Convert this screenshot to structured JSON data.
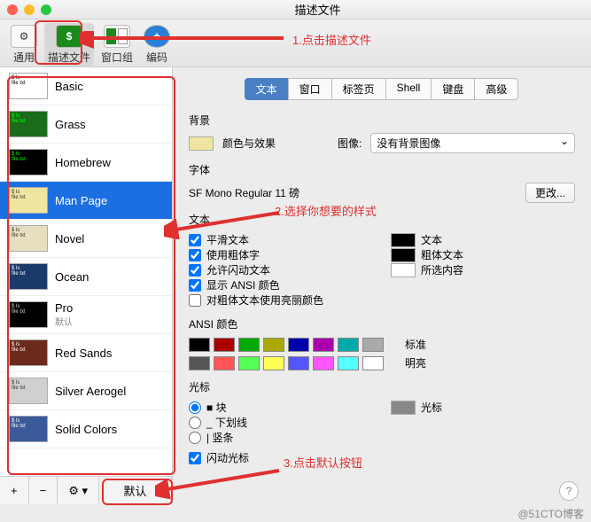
{
  "window": {
    "title": "描述文件"
  },
  "annotations": {
    "a1": "1.点击描述文件",
    "a2": "2.选择你想要的样式",
    "a3": "3.点击默认按钮",
    "watermark": "@51CTO博客"
  },
  "toolbar": {
    "general": "通用",
    "profiles": "描述文件",
    "groups": "窗口组",
    "encoding": "编码"
  },
  "profiles": [
    {
      "name": "Basic",
      "sub": "",
      "cls": "basic"
    },
    {
      "name": "Grass",
      "sub": "",
      "cls": "grass"
    },
    {
      "name": "Homebrew",
      "sub": "",
      "cls": "homebrew"
    },
    {
      "name": "Man Page",
      "sub": "",
      "cls": "manpage",
      "selected": true
    },
    {
      "name": "Novel",
      "sub": "",
      "cls": "novel"
    },
    {
      "name": "Ocean",
      "sub": "",
      "cls": "ocean"
    },
    {
      "name": "Pro",
      "sub": "默认",
      "cls": "pro"
    },
    {
      "name": "Red Sands",
      "sub": "",
      "cls": "redsands"
    },
    {
      "name": "Silver Aerogel",
      "sub": "",
      "cls": "silver"
    },
    {
      "name": "Solid Colors",
      "sub": "",
      "cls": "solid"
    }
  ],
  "sidebtns": {
    "add": "+",
    "remove": "−",
    "gear": "⚙︎ ▾",
    "default": "默认"
  },
  "tabs": [
    "文本",
    "窗口",
    "标签页",
    "Shell",
    "键盘",
    "高级"
  ],
  "active_tab": 0,
  "bg": {
    "section": "背景",
    "color_label": "颜色与效果",
    "image_label": "图像:",
    "image_select": "没有背景图像"
  },
  "font": {
    "section": "字体",
    "current": "SF Mono Regular 11 磅",
    "change": "更改..."
  },
  "text": {
    "section": "文本",
    "checks": [
      {
        "label": "平滑文本",
        "checked": true
      },
      {
        "label": "使用粗体字",
        "checked": true
      },
      {
        "label": "允许闪动文本",
        "checked": true
      },
      {
        "label": "显示 ANSI 颜色",
        "checked": true
      },
      {
        "label": "对粗体文本使用亮丽颜色",
        "checked": false
      }
    ],
    "right": [
      {
        "label": "文本",
        "color": "#000"
      },
      {
        "label": "粗体文本",
        "color": "#000"
      },
      {
        "label": "所选内容",
        "color": "#fff"
      }
    ]
  },
  "ansi": {
    "section": "ANSI 颜色",
    "row1": [
      "#000000",
      "#aa0000",
      "#00aa00",
      "#aaaa00",
      "#0000aa",
      "#aa00aa",
      "#00aaaa",
      "#aaaaaa"
    ],
    "row2": [
      "#555555",
      "#ff5555",
      "#55ff55",
      "#ffff55",
      "#5555ff",
      "#ff55ff",
      "#55ffff",
      "#ffffff"
    ],
    "label1": "标准",
    "label2": "明亮"
  },
  "cursor": {
    "section": "光标",
    "radios": [
      {
        "label": "块",
        "shape": "■",
        "checked": true
      },
      {
        "label": "下划线",
        "shape": "_",
        "checked": false
      },
      {
        "label": "竖条",
        "shape": "|",
        "checked": false
      }
    ],
    "swatch_label": "光标",
    "blink": {
      "label": "闪动光标",
      "checked": true
    }
  }
}
